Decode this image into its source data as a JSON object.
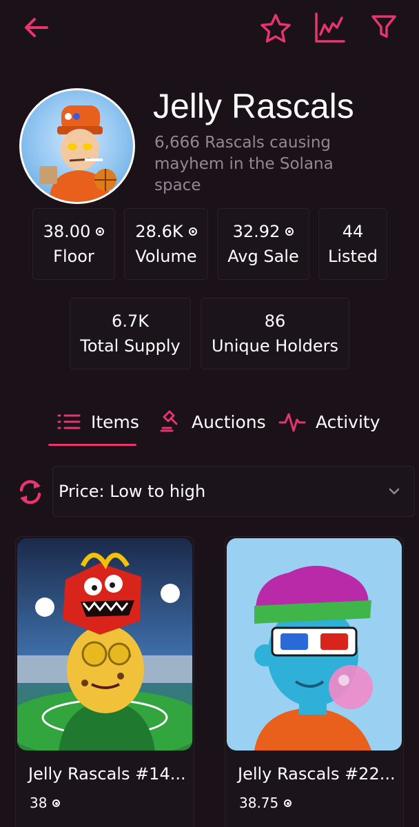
{
  "header": {
    "back_icon": "arrow-left-icon",
    "favorite_icon": "star-icon",
    "stats_icon": "line-chart-icon",
    "filter_icon": "funnel-icon",
    "accent_color": "#e8356e"
  },
  "collection": {
    "name": "Jelly Rascals",
    "description": "6,666 Rascals causing mayhem in the Solana space",
    "avatar_icon": "rascal-avatar"
  },
  "stats": [
    {
      "value": "38.00",
      "label": "Floor",
      "sol": true
    },
    {
      "value": "28.6K",
      "label": "Volume",
      "sol": true
    },
    {
      "value": "32.92",
      "label": "Avg Sale",
      "sol": true
    },
    {
      "value": "44",
      "label": "Listed",
      "sol": false
    },
    {
      "value": "6.7K",
      "label": "Total Supply",
      "sol": false
    },
    {
      "value": "86",
      "label": "Unique Holders",
      "sol": false
    }
  ],
  "tabs": [
    {
      "label": "Items",
      "icon": "list-icon",
      "active": true
    },
    {
      "label": "Auctions",
      "icon": "gavel-icon",
      "active": false
    },
    {
      "label": "Activity",
      "icon": "pulse-icon",
      "active": false
    }
  ],
  "sort": {
    "refresh_icon": "refresh-icon",
    "selected": "Price: Low to high",
    "chevron_icon": "chevron-down-icon"
  },
  "items": [
    {
      "name": "Jelly Rascals #14...",
      "price": "38"
    },
    {
      "name": "Jelly Rascals #22...",
      "price": "38.75"
    }
  ]
}
